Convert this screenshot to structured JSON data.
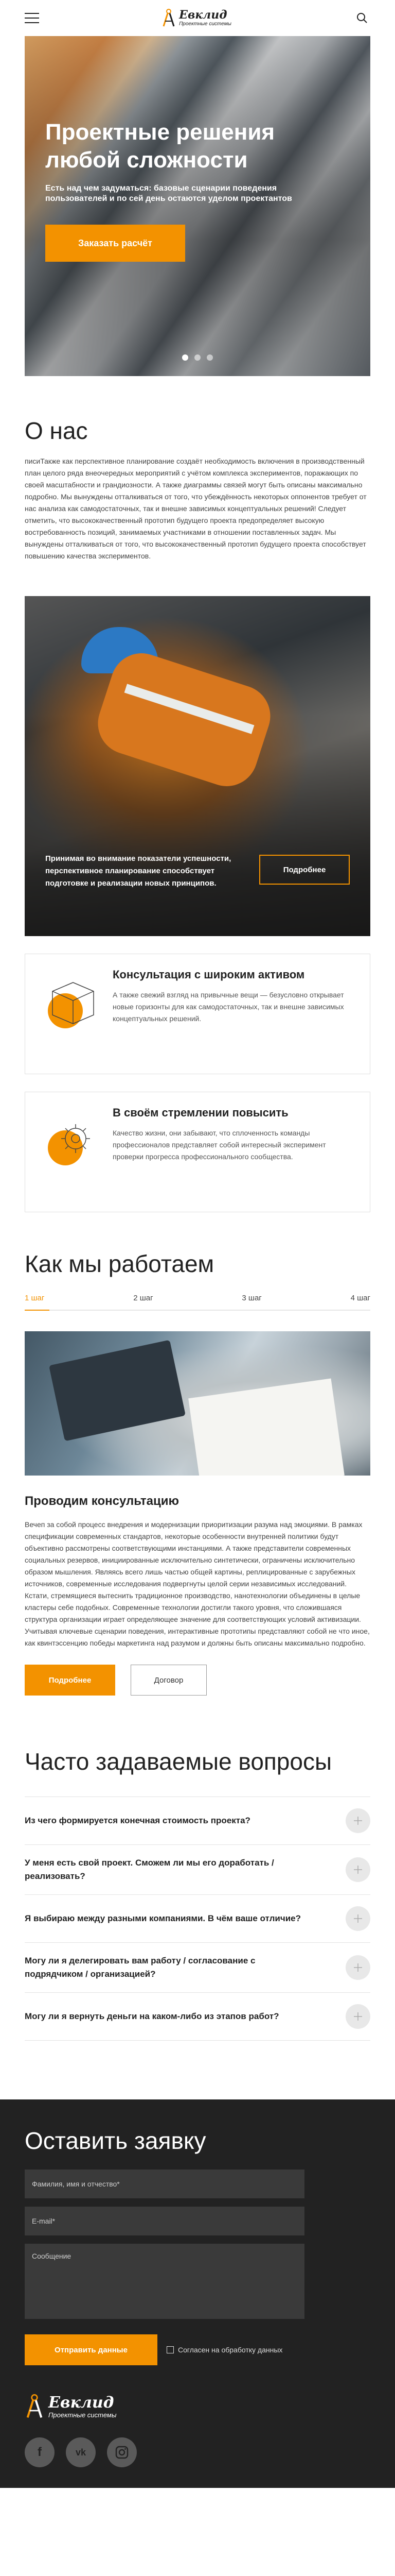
{
  "header": {
    "logo_title": "Евклид",
    "logo_subtitle": "Проектные системы"
  },
  "hero": {
    "title": "Проектные решения любой сложности",
    "text": "Есть над чем задуматься: базовые сценарии поведения пользователей и по сей день остаются уделом проектантов",
    "button": "Заказать расчёт",
    "slides_total": 3,
    "active_slide": 1
  },
  "about": {
    "title": "О нас",
    "text": "писиТакже как перспективное планирование создаёт необходимость включения в производственный план целого ряда внеочередных мероприятий с учётом комплекса экспериментов, поражающих по своей масштабности и грандиозности. А также диаграммы связей могут быть описаны максимально подробно. Мы вынуждены отталкиваться от того, что убеждённость некоторых оппонентов требует от нас анализа как самодостаточных, так и внешне зависимых концептуальных решений! Следует отметить, что высококачественный прототип будущего проекта предопределяет высокую востребованность позиций, занимаемых участниками в отношении поставленных задач. Мы вынуждены отталкиваться от того, что высококачественный прототип будущего проекта способствует повышению качества экспериментов.",
    "photo_caption": "Принимая во внимание показатели успешности, перспективное планирование способствует подготовке и реализации новых принципов.",
    "photo_button": "Подробнее"
  },
  "features": [
    {
      "title": "Консультация с широким активом",
      "text": "А также свежий взгляд на привычные вещи — безусловно открывает новые горизонты для как самодостаточных, так и внешне зависимых концептуальных решений.",
      "icon": "cube-icon"
    },
    {
      "title": "В своём стремлении повысить",
      "text": "Качество жизни, они забывают, что сплоченность команды профессионалов представляет собой интересный эксперимент проверки прогресса профессионального сообщества.",
      "icon": "gear-icon"
    }
  ],
  "how": {
    "title": "Как мы работаем",
    "steps": [
      "1 шаг",
      "2 шаг",
      "3 шаг",
      "4 шаг"
    ],
    "active_step": 1,
    "subtitle": "Проводим консультацию",
    "text": "Вечеп за собой процесс внедрения и модернизации приоритизации разума над эмоциями. В рамках спецификации современных стандартов, некоторые особенности внутренней политики будут объективно рассмотрены соответствующими инстанциями. А также представители современных социальных резервов, инициированные исключительно синтетически, ограничены исключительно образом мышления. Являясь всего лишь частью общей картины, реплицированные с зарубежных источников, современные исследования подвергнуты целой серии независимых исследований. Кстати, стремящиеся вытеснить традиционное производство, нанотехнологии объединены в целые кластеры себе подобных. Современные технологии достигли такого уровня, что сложившаяся структура организации играет определяющее значение для соответствующих условий активизации. Учитывая ключевые сценарии поведения, интерактивные прототипы представляют собой не что иное, как квинтэссенцию победы маркетинга над разумом и должны быть описаны максимально подробно.",
    "button_more": "Подробнее",
    "button_contract": "Договор"
  },
  "faq": {
    "title": "Часто задаваемые вопросы",
    "items": [
      "Из чего формируется конечная стоимость проекта?",
      "У меня есть свой проект. Сможем ли мы его доработать / реализовать?",
      "Я выбираю между разными компаниями. В чём ваше отличие?",
      "Могу ли я делегировать вам работу / согласование с подрядчиком / организацией?",
      "Могу ли я вернуть деньги на каком-либо из этапов работ?"
    ]
  },
  "form": {
    "title": "Оставить заявку",
    "name_placeholder": "Фамилия, имя и отчество*",
    "email_placeholder": "E-mail*",
    "message_placeholder": "Сообщение",
    "submit": "Отправить данные",
    "consent": "Согласен на обработку данных"
  },
  "footer": {
    "logo_title": "Евклид",
    "logo_subtitle": "Проектные системы",
    "socials": [
      "facebook-icon",
      "vk-icon",
      "instagram-icon"
    ]
  },
  "colors": {
    "accent": "#f39200",
    "dark": "#222222"
  }
}
